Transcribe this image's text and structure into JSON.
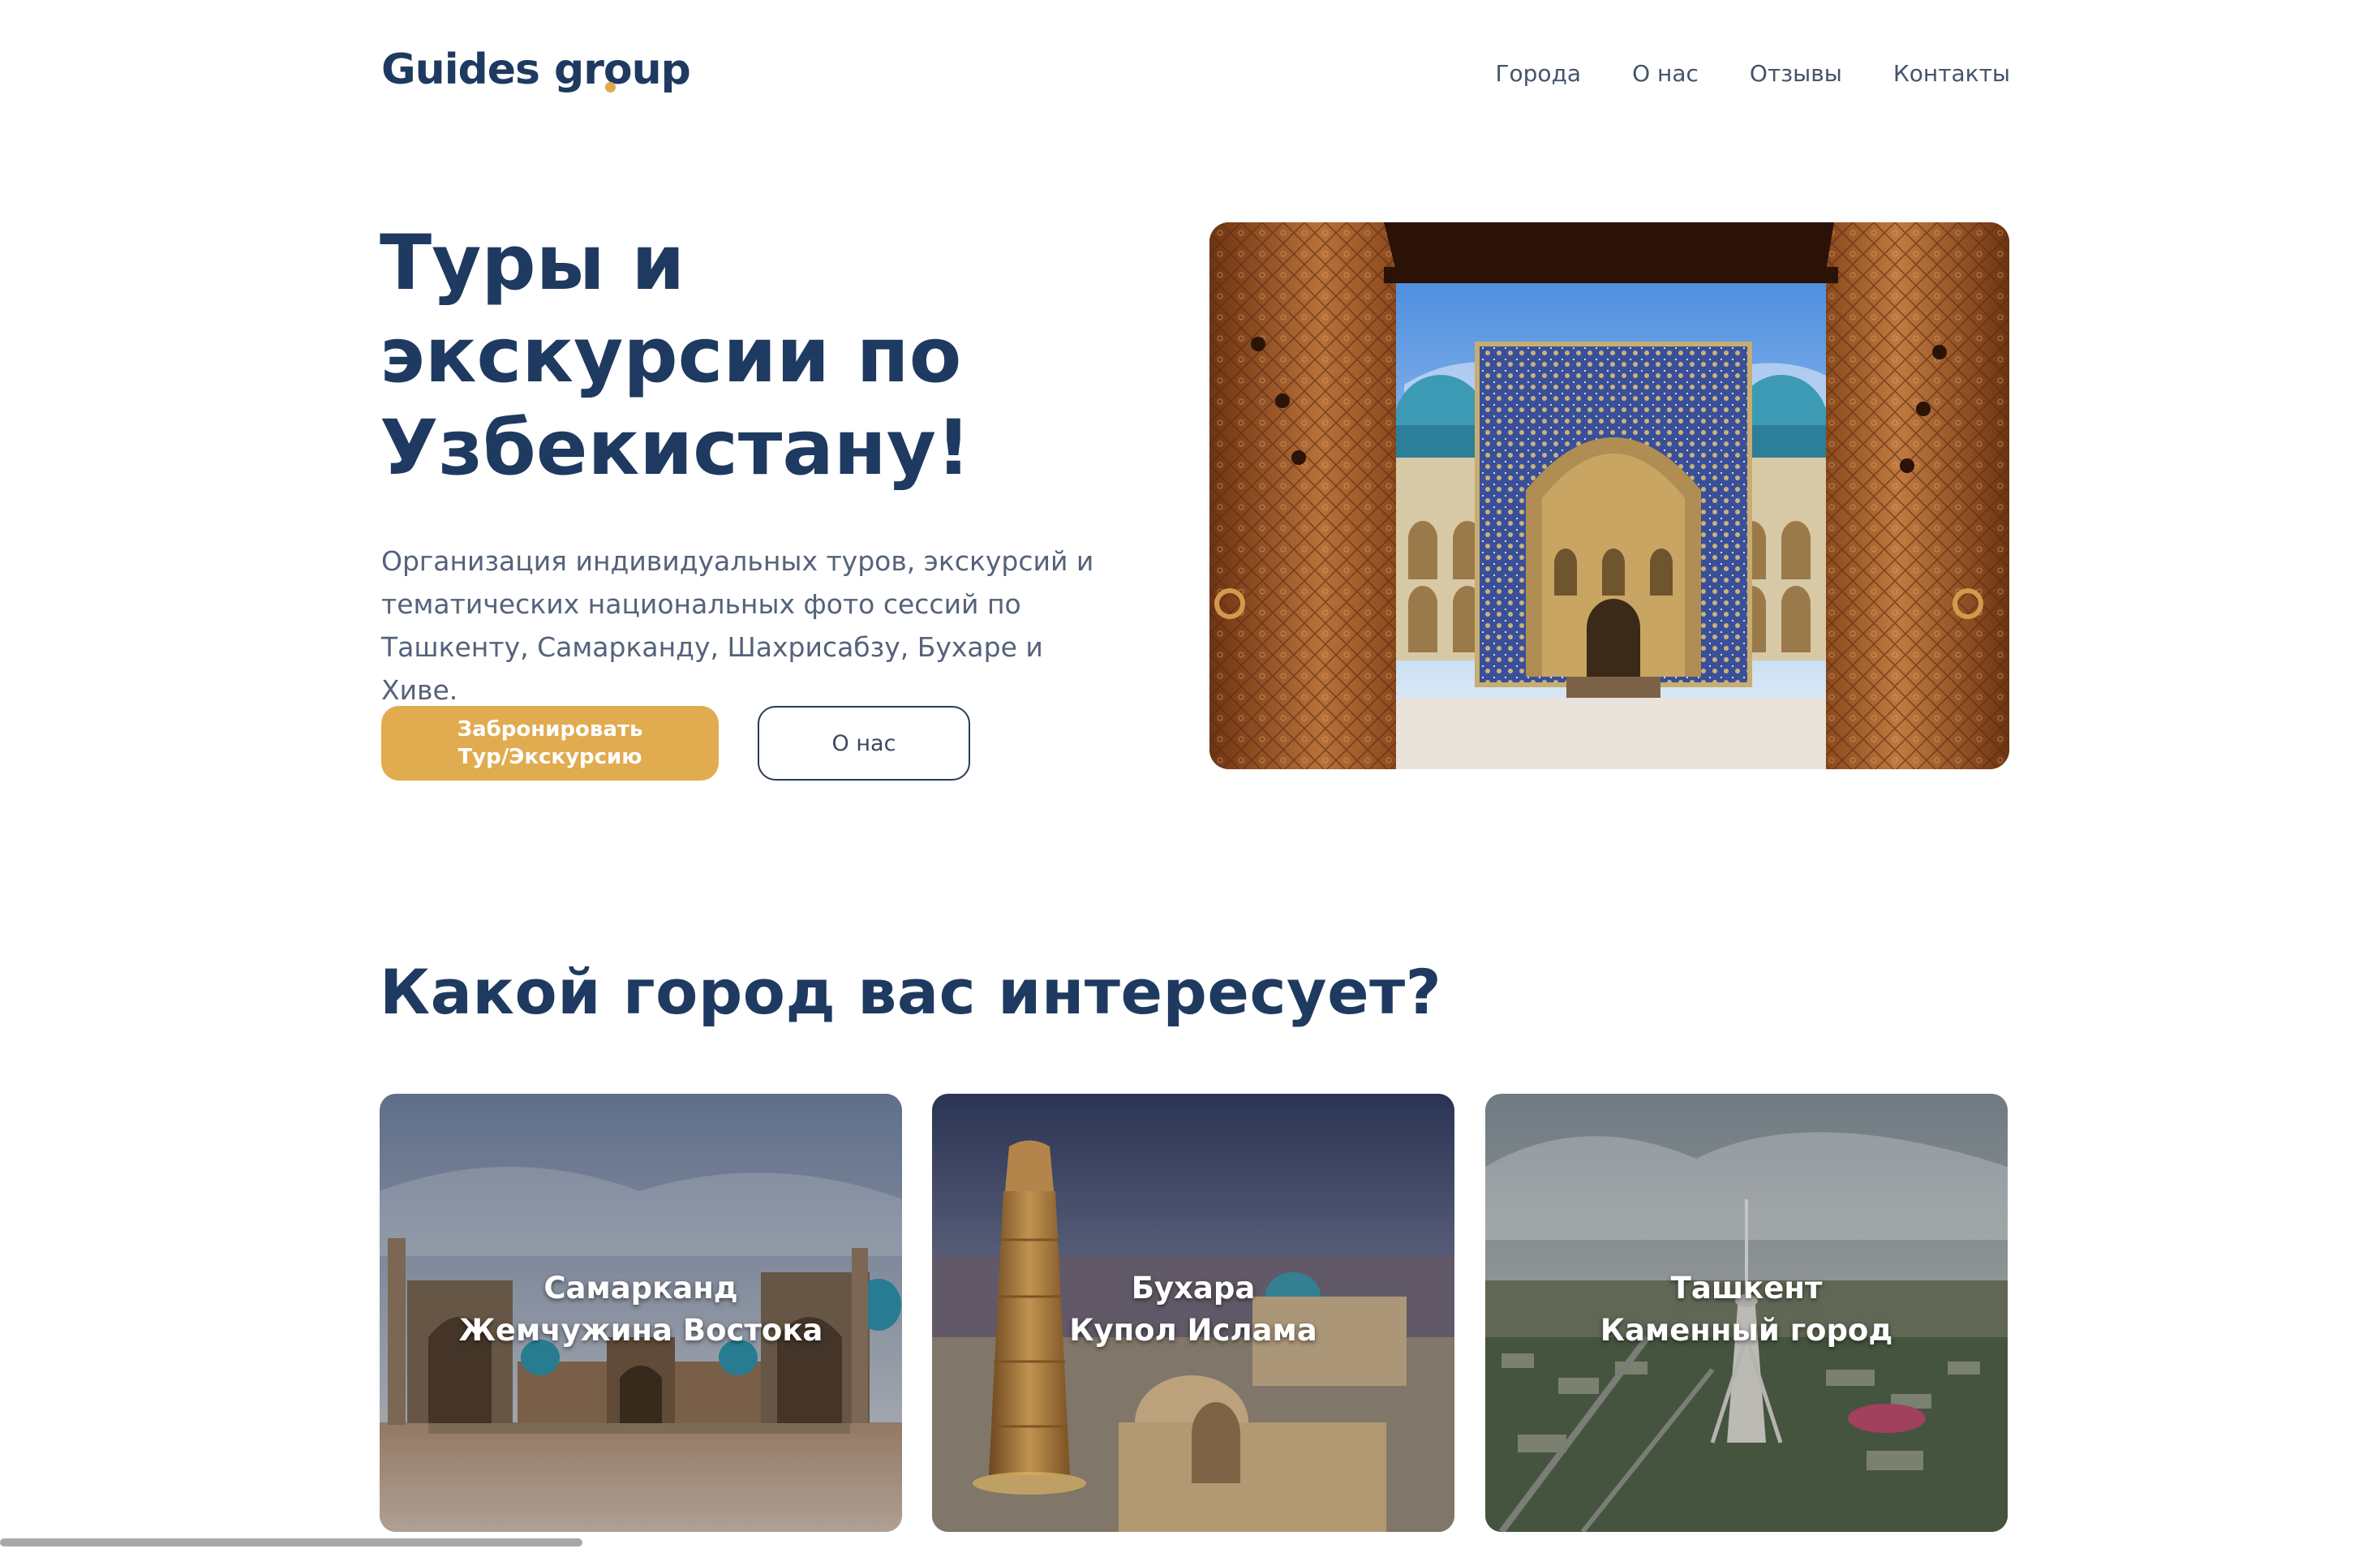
{
  "header": {
    "logo_word1": "Guides",
    "logo_word2_a": "gr",
    "logo_word2_b": "oup",
    "nav": [
      {
        "label": "Города"
      },
      {
        "label": "О нас"
      },
      {
        "label": "Отзывы"
      },
      {
        "label": "Контакты"
      }
    ]
  },
  "hero": {
    "title_lines": [
      "Туры и",
      "экскурсии по",
      "Узбекистану!"
    ],
    "subtitle_lines": [
      "Организация индивидуальных туров, экскурсий и",
      "тематических национальных фото сессий по",
      "Ташкенту, Самарканду, Шахрисабзу, Бухаре и Хиве."
    ],
    "book_button_lines": [
      "Забронировать",
      "Тур/Экскурсию"
    ],
    "about_button": "О нас",
    "image": "madrasa-through-carved-doors"
  },
  "cities": {
    "title": "Какой город вас интересует?",
    "cards": [
      {
        "name": "Самарканд",
        "tagline": "Жемчужина Востока",
        "image": "registan-square"
      },
      {
        "name": "Бухара",
        "tagline": "Купол Ислама",
        "image": "kalyan-minaret"
      },
      {
        "name": "Ташкент",
        "tagline": "Каменный город",
        "image": "tashkent-tv-tower-aerial"
      }
    ]
  },
  "colors": {
    "brand_navy": "#1f3a60",
    "accent_gold": "#e1ab50",
    "body_text": "#55627a"
  }
}
